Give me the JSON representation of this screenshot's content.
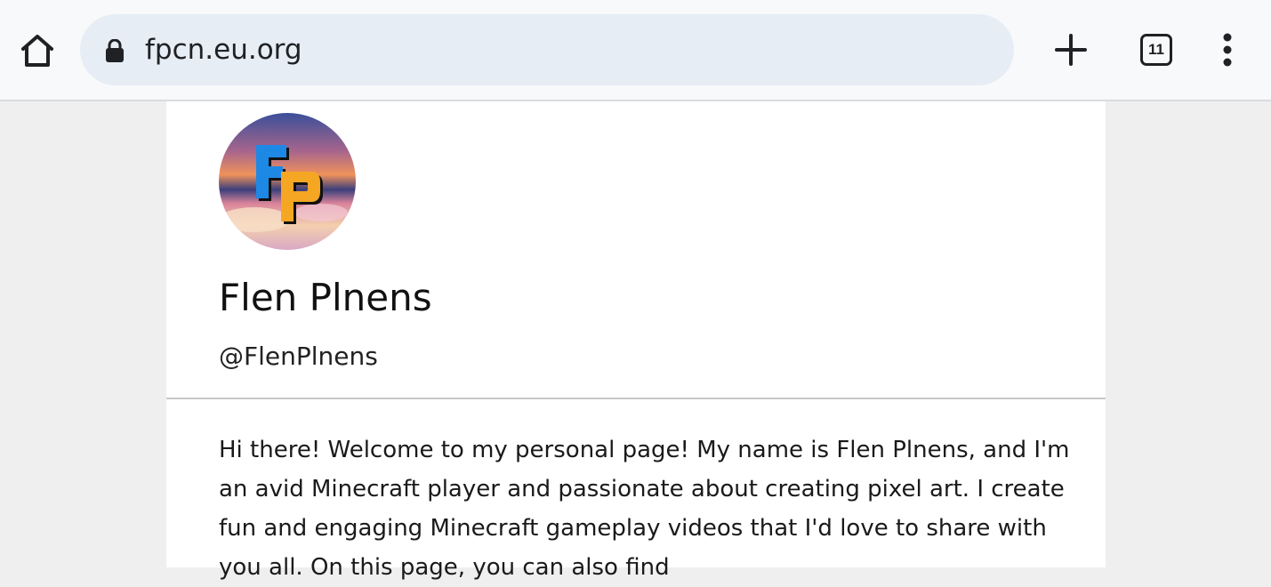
{
  "browser": {
    "url": "fpcn.eu.org",
    "tab_count": "11",
    "icons": {
      "home": "home-icon",
      "lock": "lock-icon",
      "new_tab": "plus-icon",
      "tabs": "tab-switcher-icon",
      "menu": "more-vert-icon"
    }
  },
  "profile": {
    "avatar_letters": "FP",
    "name": "Flen Plnens",
    "handle": "@FlenPlnens",
    "bio": "Hi there! Welcome to my personal page! My name is Flen Plnens, and I'm an avid Minecraft player and passionate about creating pixel art. I create fun and engaging Minecraft gameplay videos that I'd love to share with you all. On this page, you can also find"
  },
  "colors": {
    "toolbar_bg": "#f8f9fb",
    "omnibox_bg": "#e6edf5",
    "page_bg": "#efefef",
    "card_bg": "#ffffff",
    "logo_blue": "#1e88e5",
    "logo_orange": "#f5a623"
  }
}
